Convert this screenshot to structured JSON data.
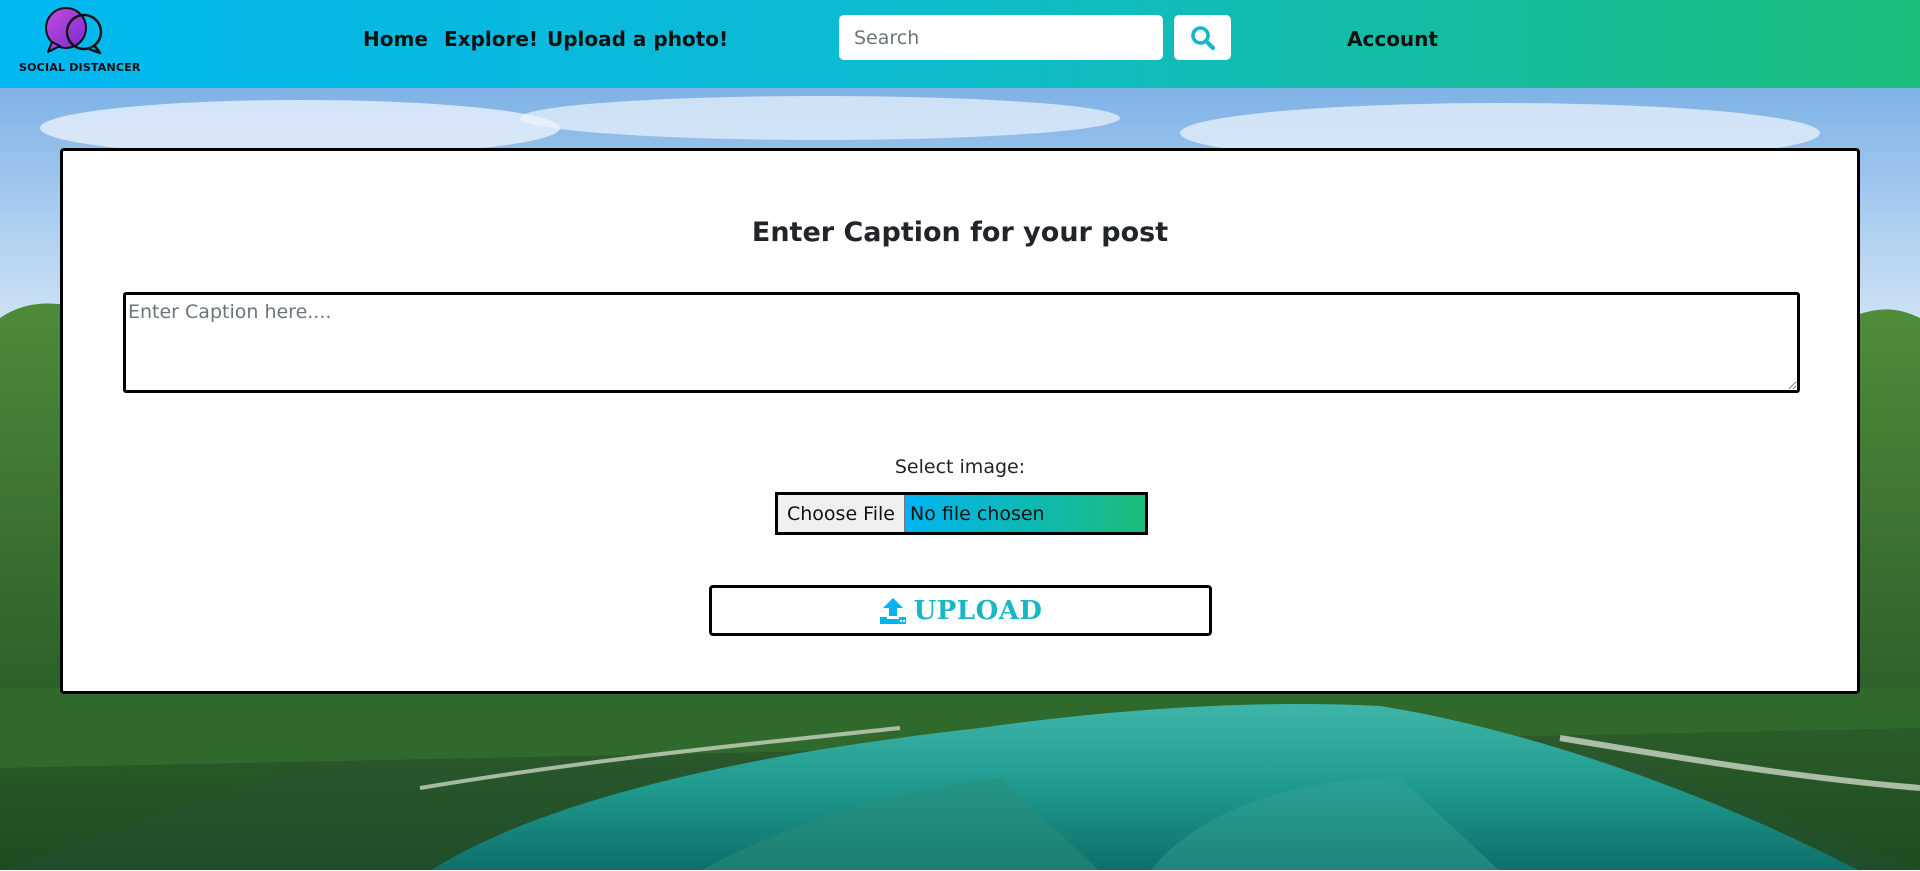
{
  "brand": {
    "name": "SOCIAL DISTANCER"
  },
  "nav": {
    "items": [
      {
        "label": "Home"
      },
      {
        "label": "Explore!"
      },
      {
        "label": "Upload a photo!"
      }
    ],
    "account": "Account"
  },
  "search": {
    "placeholder": "Search",
    "icon": "search-icon"
  },
  "form": {
    "title": "Enter Caption for your post",
    "caption_placeholder": "Enter Caption here....",
    "select_label": "Select image:",
    "choose_label": "Choose File",
    "no_file": "No file chosen",
    "upload_label": "UPLOAD",
    "upload_icon": "upload-icon"
  },
  "colors": {
    "header_start": "#00b7f1",
    "header_end": "#1bbd7a",
    "accent": "#19b7c4"
  }
}
